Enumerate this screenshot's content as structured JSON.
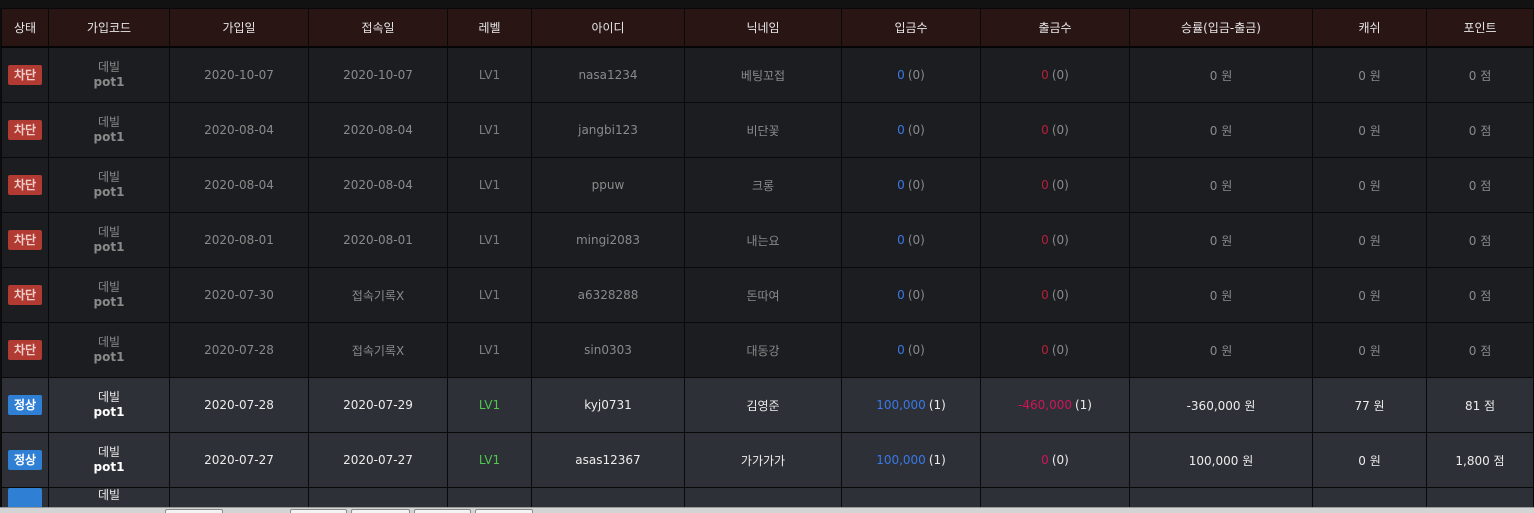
{
  "headers": [
    "상태",
    "가입코드",
    "가입일",
    "접속일",
    "레벨",
    "아이디",
    "닉네임",
    "입금수",
    "출금수",
    "승률(입금-출금)",
    "캐쉬",
    "포인트"
  ],
  "rows": [
    {
      "status": "차단",
      "code_name": "데빌",
      "code_sub": "pot1",
      "join_date": "2020-10-07",
      "access_date": "2020-10-07",
      "level": "LV1",
      "user_id": "nasa1234",
      "nickname": "베팅꼬접",
      "deposit": "0",
      "deposit_count": "(0)",
      "withdraw": "0",
      "withdraw_count": "(0)",
      "win_rate": "0 원",
      "cash": "0 원",
      "point": "0 점"
    },
    {
      "status": "차단",
      "code_name": "데빌",
      "code_sub": "pot1",
      "join_date": "2020-08-04",
      "access_date": "2020-08-04",
      "level": "LV1",
      "user_id": "jangbi123",
      "nickname": "비단꽃",
      "deposit": "0",
      "deposit_count": "(0)",
      "withdraw": "0",
      "withdraw_count": "(0)",
      "win_rate": "0 원",
      "cash": "0 원",
      "point": "0 점"
    },
    {
      "status": "차단",
      "code_name": "데빌",
      "code_sub": "pot1",
      "join_date": "2020-08-04",
      "access_date": "2020-08-04",
      "level": "LV1",
      "user_id": "ppuw",
      "nickname": "크롱",
      "deposit": "0",
      "deposit_count": "(0)",
      "withdraw": "0",
      "withdraw_count": "(0)",
      "win_rate": "0 원",
      "cash": "0 원",
      "point": "0 점"
    },
    {
      "status": "차단",
      "code_name": "데빌",
      "code_sub": "pot1",
      "join_date": "2020-08-01",
      "access_date": "2020-08-01",
      "level": "LV1",
      "user_id": "mingi2083",
      "nickname": "내는요",
      "deposit": "0",
      "deposit_count": "(0)",
      "withdraw": "0",
      "withdraw_count": "(0)",
      "win_rate": "0 원",
      "cash": "0 원",
      "point": "0 점"
    },
    {
      "status": "차단",
      "code_name": "데빌",
      "code_sub": "pot1",
      "join_date": "2020-07-30",
      "access_date": "접속기록X",
      "level": "LV1",
      "user_id": "a6328288",
      "nickname": "돈따여",
      "deposit": "0",
      "deposit_count": "(0)",
      "withdraw": "0",
      "withdraw_count": "(0)",
      "win_rate": "0 원",
      "cash": "0 원",
      "point": "0 점"
    },
    {
      "status": "차단",
      "code_name": "데빌",
      "code_sub": "pot1",
      "join_date": "2020-07-28",
      "access_date": "접속기록X",
      "level": "LV1",
      "user_id": "sin0303",
      "nickname": "대동강",
      "deposit": "0",
      "deposit_count": "(0)",
      "withdraw": "0",
      "withdraw_count": "(0)",
      "win_rate": "0 원",
      "cash": "0 원",
      "point": "0 점"
    },
    {
      "status": "정상",
      "code_name": "데빌",
      "code_sub": "pot1",
      "join_date": "2020-07-28",
      "access_date": "2020-07-29",
      "level": "LV1",
      "user_id": "kyj0731",
      "nickname": "김영준",
      "deposit": "100,000",
      "deposit_count": "(1)",
      "withdraw": "-460,000",
      "withdraw_count": "(1)",
      "win_rate": "-360,000 원",
      "cash": "77 원",
      "point": "81 점"
    },
    {
      "status": "정상",
      "code_name": "데빌",
      "code_sub": "pot1",
      "join_date": "2020-07-27",
      "access_date": "2020-07-27",
      "level": "LV1",
      "user_id": "asas12367",
      "nickname": "가가가가",
      "deposit": "100,000",
      "deposit_count": "(1)",
      "withdraw": "0",
      "withdraw_count": "(0)",
      "win_rate": "100,000 원",
      "cash": "0 원",
      "point": "1,800 점"
    }
  ],
  "partial_row": {
    "code_name": "데빌"
  },
  "colors": {
    "header_bg": "#2a1515",
    "blocked_badge": "#b13a33",
    "normal_badge": "#2f7fd4",
    "deposit": "#3a78e6",
    "withdraw": "#d2145a",
    "level_active": "#4fc64f"
  }
}
